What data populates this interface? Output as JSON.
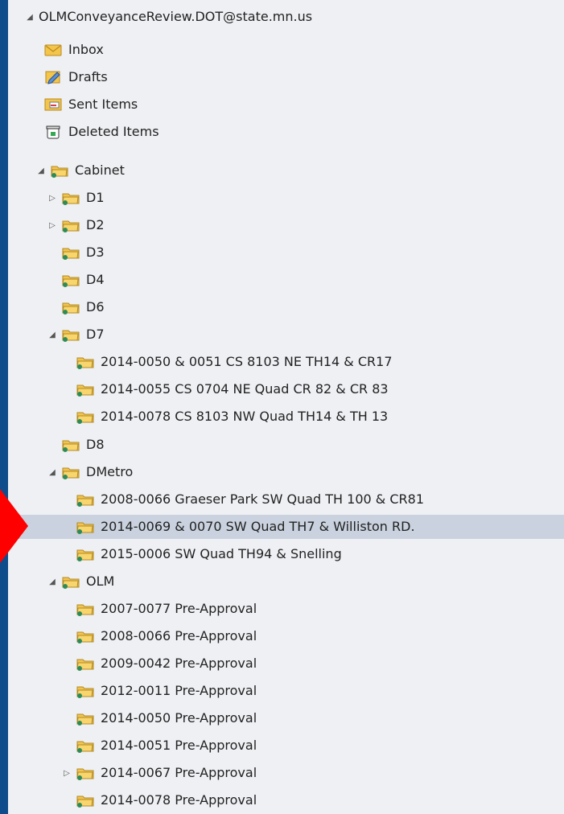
{
  "account": "OLMConveyanceReview.DOT@state.mn.us",
  "special_folders": [
    {
      "label": "Inbox",
      "icon": "inbox-icon"
    },
    {
      "label": "Drafts",
      "icon": "drafts-icon"
    },
    {
      "label": "Sent Items",
      "icon": "sent-items-icon"
    },
    {
      "label": "Deleted Items",
      "icon": "deleted-items-icon"
    }
  ],
  "cabinet": {
    "label": "Cabinet",
    "folders": [
      {
        "label": "D1",
        "expandable": true
      },
      {
        "label": "D2",
        "expandable": true
      },
      {
        "label": "D3"
      },
      {
        "label": "D4"
      },
      {
        "label": "D6"
      },
      {
        "label": "D7",
        "expanded": true,
        "children": [
          {
            "label": "2014-0050 & 0051 CS 8103 NE TH14 & CR17"
          },
          {
            "label": "2014-0055 CS 0704 NE Quad CR 82 & CR 83"
          },
          {
            "label": "2014-0078 CS 8103 NW Quad TH14 & TH 13"
          }
        ]
      },
      {
        "label": "D8"
      },
      {
        "label": "DMetro",
        "expanded": true,
        "children": [
          {
            "label": "2008-0066 Graeser Park SW Quad TH 100 & CR81"
          },
          {
            "label": "2014-0069 & 0070 SW Quad TH7 & Williston RD.",
            "selected": true
          },
          {
            "label": "2015-0006 SW Quad TH94 & Snelling"
          }
        ]
      },
      {
        "label": "OLM",
        "expanded": true,
        "children": [
          {
            "label": "2007-0077 Pre-Approval"
          },
          {
            "label": "2008-0066 Pre-Approval"
          },
          {
            "label": "2009-0042 Pre-Approval"
          },
          {
            "label": "2012-0011 Pre-Approval"
          },
          {
            "label": "2014-0050 Pre-Approval"
          },
          {
            "label": "2014-0051 Pre-Approval"
          },
          {
            "label": "2014-0067 Pre-Approval",
            "expandable": true
          },
          {
            "label": "2014-0078 Pre-Approval"
          }
        ]
      }
    ]
  },
  "colors": {
    "background": "#0f4c8c",
    "pane": "#eef0f3",
    "selection": "#c9d2de",
    "pointer": "#ff0000"
  }
}
